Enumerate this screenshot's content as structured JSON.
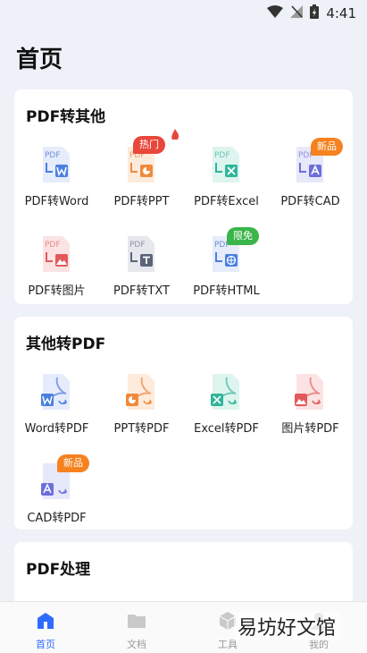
{
  "status": {
    "time": "4:41"
  },
  "page": {
    "title": "首页"
  },
  "sections": [
    {
      "title": "PDF转其他",
      "items": [
        {
          "label": "PDF转Word",
          "badge": ""
        },
        {
          "label": "PDF转PPT",
          "badge": "热门"
        },
        {
          "label": "PDF转Excel",
          "badge": ""
        },
        {
          "label": "PDF转CAD",
          "badge": "新品"
        },
        {
          "label": "PDF转图片",
          "badge": ""
        },
        {
          "label": "PDF转TXT",
          "badge": ""
        },
        {
          "label": "PDF转HTML",
          "badge": "限免"
        }
      ]
    },
    {
      "title": "其他转PDF",
      "items": [
        {
          "label": "Word转PDF",
          "badge": ""
        },
        {
          "label": "PPT转PDF",
          "badge": ""
        },
        {
          "label": "Excel转PDF",
          "badge": ""
        },
        {
          "label": "图片转PDF",
          "badge": ""
        },
        {
          "label": "CAD转PDF",
          "badge": "新品"
        }
      ]
    },
    {
      "title": "PDF处理",
      "items": []
    }
  ],
  "doc_text": "PDF",
  "tabs": [
    {
      "label": "首页"
    },
    {
      "label": "文档"
    },
    {
      "label": "工具"
    },
    {
      "label": "我的"
    }
  ],
  "watermark": "易坊好文馆",
  "colors": {
    "accent": "#2f6bff",
    "hot": "#e8473b",
    "new": "#f5821f",
    "free": "#3bb54a",
    "word": "#4a7fe0",
    "ppt": "#f08a3c",
    "excel": "#2fb59a",
    "cad": "#6a6fd9",
    "image": "#e2595b",
    "txt": "#5b6478",
    "html": "#4a7fe0"
  }
}
